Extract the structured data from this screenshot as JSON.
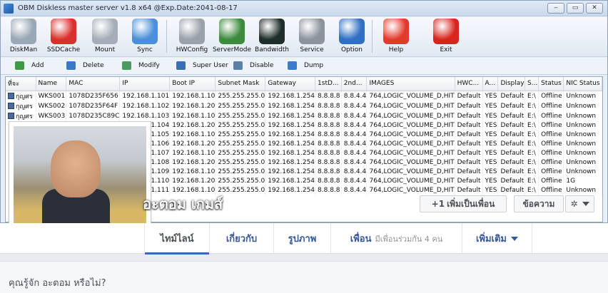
{
  "window": {
    "title": "OBM Diskless master server v1.8 x64 @Exp.Date:2041-08-17",
    "buttons": [
      "‒",
      "▭",
      "✕"
    ]
  },
  "toolbar": [
    {
      "label": "DiskMan",
      "icon": "disk-manager-icon",
      "color": "#9aa7b6"
    },
    {
      "label": "SSDCache",
      "icon": "ssd-cache-icon",
      "color": "#d9302c"
    },
    {
      "label": "Mount",
      "icon": "mount-disk-icon",
      "color": "#a5aeb8"
    },
    {
      "label": "Sync",
      "icon": "sync-users-icon",
      "color": "#4b8fd8"
    },
    {
      "label": "HWConfig",
      "icon": "hardware-config-icon",
      "color": "#9aa1ab"
    },
    {
      "label": "ServerMode",
      "icon": "server-mode-icon",
      "color": "#3d8b3d"
    },
    {
      "label": "Bandwidth",
      "icon": "bandwidth-icon",
      "color": "#1f2e2a"
    },
    {
      "label": "Service",
      "icon": "service-gears-icon",
      "color": "#8c939c"
    },
    {
      "label": "Option",
      "icon": "option-icon",
      "color": "#2f6fc4"
    },
    {
      "label": "Help",
      "icon": "help-windows-icon",
      "color": "#e23b2e"
    },
    {
      "label": "Exit",
      "icon": "exit-power-icon",
      "color": "#d8261f"
    }
  ],
  "commands": [
    {
      "label": "Add",
      "icon": "add-icon"
    },
    {
      "label": "Delete",
      "icon": "delete-icon"
    },
    {
      "label": "Modify",
      "icon": "modify-icon"
    },
    {
      "label": "Super User",
      "icon": "super-user-icon"
    },
    {
      "label": "Disable",
      "icon": "disable-icon"
    },
    {
      "label": "Dump",
      "icon": "dump-icon"
    }
  ],
  "table": {
    "columns": [
      "ที่จะ",
      "Name",
      "MAC",
      "IP",
      "Boot IP",
      "Subnet Mask",
      "Gateway",
      "1stD...",
      "2nd...",
      "IMAGES",
      "HWC...",
      "A...",
      "Display",
      "S...",
      "Status",
      "NIC Status"
    ],
    "rows": [
      [
        "กุญศร",
        "WKS001",
        "1078D235F656",
        "192.168.1.101",
        "192.168.1.10",
        "255.255.255.0",
        "192.168.1.254",
        "8.8.8.8",
        "8.8.4.4",
        "764,LOGIC_VOLUME_D,HIT",
        "Default",
        "YES",
        "Default",
        "E:\\",
        "Offline",
        "Unknown"
      ],
      [
        "กุญศร",
        "WKS002",
        "1078D235F64F",
        "192.168.1.102",
        "192.168.1.20",
        "255.255.255.0",
        "192.168.1.254",
        "8.8.8.8",
        "8.8.4.4",
        "764,LOGIC_VOLUME_D,HIT",
        "Default",
        "YES",
        "Default",
        "E:\\",
        "Offline",
        "Unknown"
      ],
      [
        "กุญศร",
        "WKS003",
        "1078D235C89C",
        "192.168.1.103",
        "192.168.1.10",
        "255.255.255.0",
        "192.168.1.254",
        "8.8.8.8",
        "8.8.4.4",
        "764,LOGIC_VOLUME_D,HIT",
        "Default",
        "YES",
        "Default",
        "E:\\",
        "Offline",
        "Unknown"
      ],
      [
        "",
        "",
        "",
        "192.168.1.104",
        "192.168.1.20",
        "255.255.255.0",
        "192.168.1.254",
        "8.8.8.8",
        "8.8.4.4",
        "764,LOGIC_VOLUME_D,HIT",
        "Default",
        "YES",
        "Default",
        "E:\\",
        "Offline",
        "Unknown"
      ],
      [
        "",
        "",
        "",
        "192.168.1.105",
        "192.168.1.10",
        "255.255.255.0",
        "192.168.1.254",
        "8.8.8.8",
        "8.8.4.4",
        "764,LOGIC_VOLUME_D,HIT",
        "Default",
        "YES",
        "Default",
        "E:\\",
        "Offline",
        "Unknown"
      ],
      [
        "",
        "",
        "",
        "192.168.1.106",
        "192.168.1.20",
        "255.255.255.0",
        "192.168.1.254",
        "8.8.8.8",
        "8.8.4.4",
        "764,LOGIC_VOLUME_D,HIT",
        "Default",
        "YES",
        "Default",
        "E:\\",
        "Offline",
        "Unknown"
      ],
      [
        "",
        "",
        "",
        "192.168.1.107",
        "192.168.1.10",
        "255.255.255.0",
        "192.168.1.254",
        "8.8.8.8",
        "8.8.4.4",
        "764,LOGIC_VOLUME_D,HIT",
        "Default",
        "YES",
        "Default",
        "E:\\",
        "Offline",
        "Unknown"
      ],
      [
        "",
        "",
        "",
        "192.168.1.108",
        "192.168.1.20",
        "255.255.255.0",
        "192.168.1.254",
        "8.8.8.8",
        "8.8.4.4",
        "764,LOGIC_VOLUME_D,HIT",
        "Default",
        "YES",
        "Default",
        "E:\\",
        "Offline",
        "Unknown"
      ],
      [
        "",
        "",
        "",
        "192.168.1.109",
        "192.168.1.10",
        "255.255.255.0",
        "192.168.1.254",
        "8.8.8.8",
        "8.8.4.4",
        "764,LOGIC_VOLUME_D,HIT",
        "Default",
        "YES",
        "Default",
        "E:\\",
        "Offline",
        "Unknown"
      ],
      [
        "",
        "",
        "",
        "192.168.1.110",
        "192.168.1.20",
        "255.255.255.0",
        "192.168.1.254",
        "8.8.8.8",
        "8.8.4.4",
        "764,LOGIC_VOLUME_D,HIT",
        "Default",
        "YES",
        "Default",
        "E:\\",
        "Offline",
        "1G"
      ],
      [
        "",
        "",
        "",
        "192.168.1.111",
        "192.168.1.10",
        "255.255.255.0",
        "192.168.1.254",
        "8.8.8.8",
        "8.8.4.4",
        "764,LOGIC_VOLUME_D,HIT",
        "Default",
        "YES",
        "Default",
        "E:\\",
        "Offline",
        "Unknown"
      ]
    ]
  },
  "profile": {
    "name": "อะตอม เกมส์",
    "add_friend": "เพิ่มเป็นเพื่อน",
    "add_friend_icon": "+1",
    "message": "ข้อความ",
    "gear_icon": "✲"
  },
  "nav": {
    "tabs": [
      {
        "label": "ไทม์ไลน์"
      },
      {
        "label": "เกี่ยวกับ"
      },
      {
        "label": "รูปภาพ"
      },
      {
        "label": "เพื่อน",
        "sub": "มีเพื่อนร่วมกัน 4 คน"
      },
      {
        "label": "เพิ่มเติม"
      }
    ]
  },
  "know": {
    "text": "คุณรู้จัก อะตอม หรือไม่?"
  }
}
